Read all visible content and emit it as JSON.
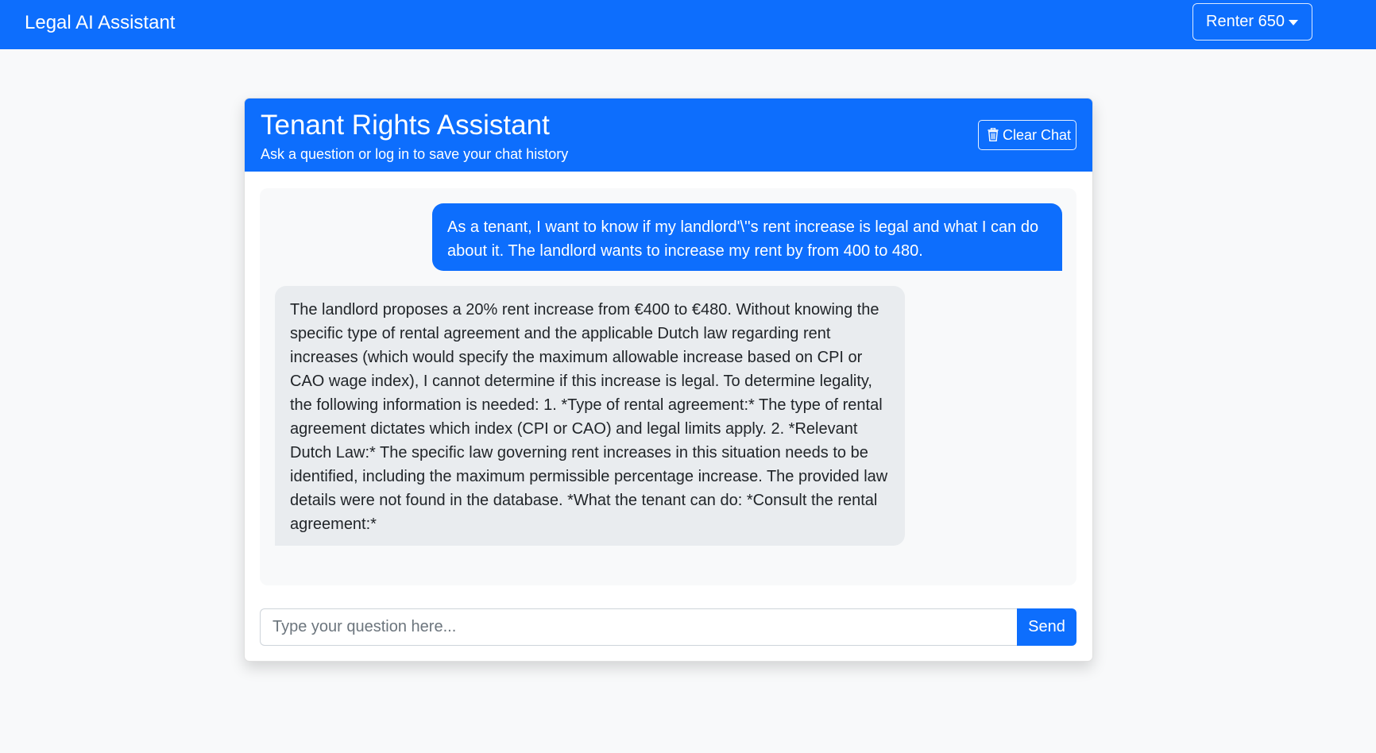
{
  "navbar": {
    "brand": "Legal AI Assistant",
    "user_menu_label": "Renter 650"
  },
  "card": {
    "title": "Tenant Rights Assistant",
    "subtitle": "Ask a question or log in to save your chat history",
    "clear_label": "Clear Chat"
  },
  "messages": [
    {
      "role": "user",
      "text": "As a tenant, I want to know if my landlord'\\''s rent increase is legal and what I can do about it. The landlord wants to increase my rent by from 400 to 480."
    },
    {
      "role": "assistant",
      "text": "The landlord proposes a 20% rent increase from €400 to €480. Without knowing the specific type of rental agreement and the applicable Dutch law regarding rent increases (which would specify the maximum allowable increase based on CPI or CAO wage index), I cannot determine if this increase is legal. To determine legality, the following information is needed: 1. *Type of rental agreement:* The type of rental agreement dictates which index (CPI or CAO) and legal limits apply. 2. *Relevant Dutch Law:* The specific law governing rent increases in this situation needs to be identified, including the maximum permissible percentage increase. The provided law details were not found in the database. *What the tenant can do: *Consult the rental agreement:*"
    }
  ],
  "input": {
    "placeholder": "Type your question here...",
    "value": ""
  },
  "send_label": "Send",
  "icons": {
    "clear": "trash-icon",
    "user_menu": "caret-down-icon"
  },
  "colors": {
    "primary": "#0d6efd",
    "page_background": "#f8f9fa",
    "bot_bubble": "#e9ecef"
  }
}
